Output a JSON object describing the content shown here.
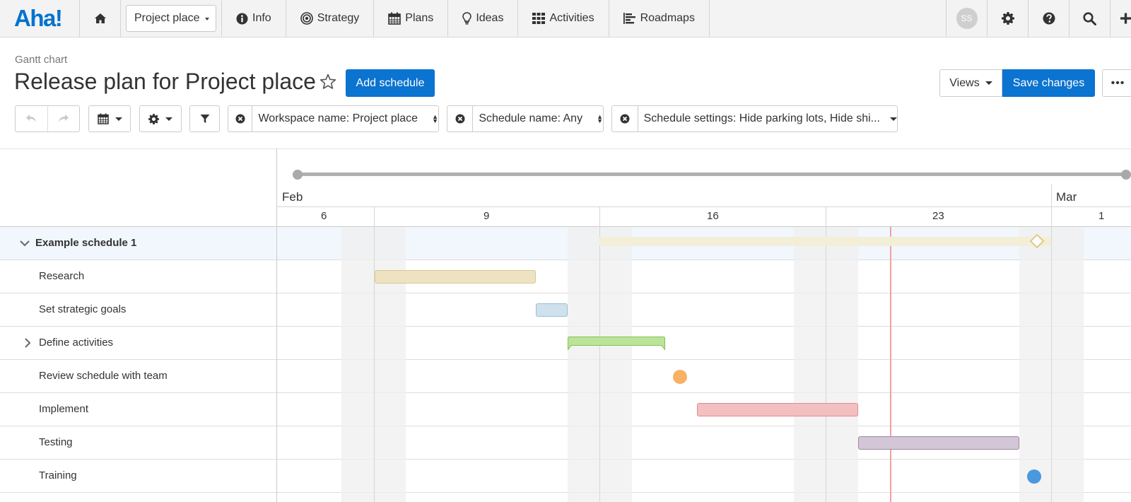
{
  "nav": {
    "logo": "Aha!",
    "workspace": "Project place",
    "items": [
      {
        "label": "Info",
        "icon": "info-icon"
      },
      {
        "label": "Strategy",
        "icon": "target-icon"
      },
      {
        "label": "Plans",
        "icon": "calendar-icon"
      },
      {
        "label": "Ideas",
        "icon": "lightbulb-icon"
      },
      {
        "label": "Activities",
        "icon": "grid-icon"
      },
      {
        "label": "Roadmaps",
        "icon": "roadmap-icon"
      }
    ],
    "user_initials": "SS"
  },
  "header": {
    "breadcrumb": "Gantt chart",
    "title": "Release plan for Project place",
    "add_schedule": "Add schedule",
    "views": "Views",
    "save_changes": "Save changes",
    "more": "•••"
  },
  "toolbar": {
    "filters": [
      {
        "label": "Workspace name: Project place"
      },
      {
        "label": "Schedule name: Any"
      },
      {
        "label": "Schedule settings: Hide parking lots, Hide shi..."
      }
    ]
  },
  "gantt": {
    "months": [
      "Feb",
      "Mar"
    ],
    "days": [
      "6",
      "9",
      "16",
      "23",
      "1"
    ],
    "rows": [
      {
        "label": "Example schedule 1",
        "type": "group"
      },
      {
        "label": "Research",
        "type": "task",
        "color": "#ede3c2"
      },
      {
        "label": "Set strategic goals",
        "type": "task",
        "color": "#cfe1ec"
      },
      {
        "label": "Define activities",
        "type": "summary",
        "color": "#bde39a"
      },
      {
        "label": "Review schedule with team",
        "type": "milestone",
        "color": "#f7b265"
      },
      {
        "label": "Implement",
        "type": "task",
        "color": "#f2c0c1"
      },
      {
        "label": "Testing",
        "type": "task",
        "color": "#d3c6d6"
      },
      {
        "label": "Training",
        "type": "milestone",
        "color": "#4a99de"
      }
    ]
  },
  "colors": {
    "brand": "#0073cf",
    "primary_button": "#0b73d0",
    "today": "#f1a1a3"
  }
}
